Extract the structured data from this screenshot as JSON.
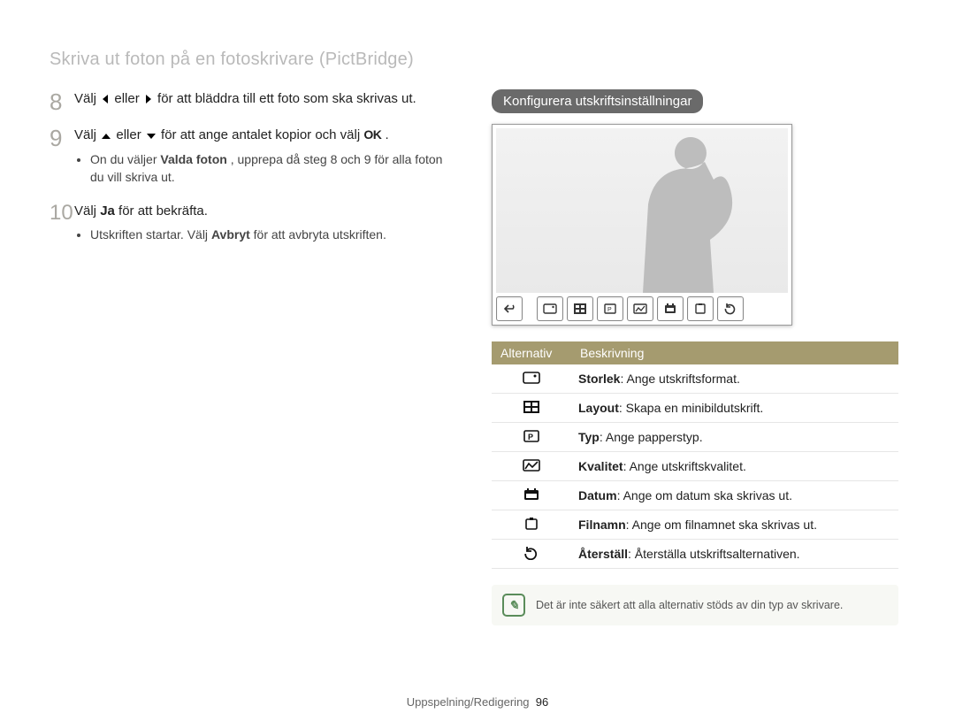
{
  "page_title": "Skriva ut foton på en fotoskrivare (PictBridge)",
  "steps": {
    "s8": {
      "num": "8",
      "pre": "Välj ",
      "mid": " eller ",
      "post": " för att bläddra till ett foto som ska skrivas ut."
    },
    "s9": {
      "num": "9",
      "pre": "Välj ",
      "mid": " eller ",
      "post1": " för att ange antalet kopior och välj ",
      "ok": "OK",
      "post2": ".",
      "bullet_pre": "On du väljer ",
      "bullet_bold": "Valda foton",
      "bullet_post": ", upprepa då steg 8 och 9 för alla foton du vill skriva ut."
    },
    "s10": {
      "num": "10",
      "pre": "Välj ",
      "bold": "Ja",
      "post": " för att bekräfta.",
      "bullet_pre": "Utskriften startar. Välj ",
      "bullet_bold": "Avbryt",
      "bullet_post": " för att avbryta utskriften."
    }
  },
  "right": {
    "section_title": "Konfigurera utskriftsinställningar",
    "preview_back_label": "Tillbaka",
    "table": {
      "header_option": "Alternativ",
      "header_desc": "Beskrivning",
      "rows": [
        {
          "icon": "size",
          "label": "Storlek",
          "desc": ": Ange utskriftsformat."
        },
        {
          "icon": "layout",
          "label": "Layout",
          "desc": ": Skapa en minibildutskrift."
        },
        {
          "icon": "type",
          "label": "Typ",
          "desc": ": Ange papperstyp."
        },
        {
          "icon": "quality",
          "label": "Kvalitet",
          "desc": ": Ange utskriftskvalitet."
        },
        {
          "icon": "date",
          "label": "Datum",
          "desc": ": Ange om datum ska skrivas ut."
        },
        {
          "icon": "filename",
          "label": "Filnamn",
          "desc": ": Ange om filnamnet ska skrivas ut."
        },
        {
          "icon": "reset",
          "label": "Återställ",
          "desc": ": Återställa utskriftsalternativen."
        }
      ]
    },
    "note": "Det är inte säkert att alla alternativ stöds av din typ av skrivare."
  },
  "footer": {
    "section": "Uppspelning/Redigering",
    "page": "96"
  }
}
